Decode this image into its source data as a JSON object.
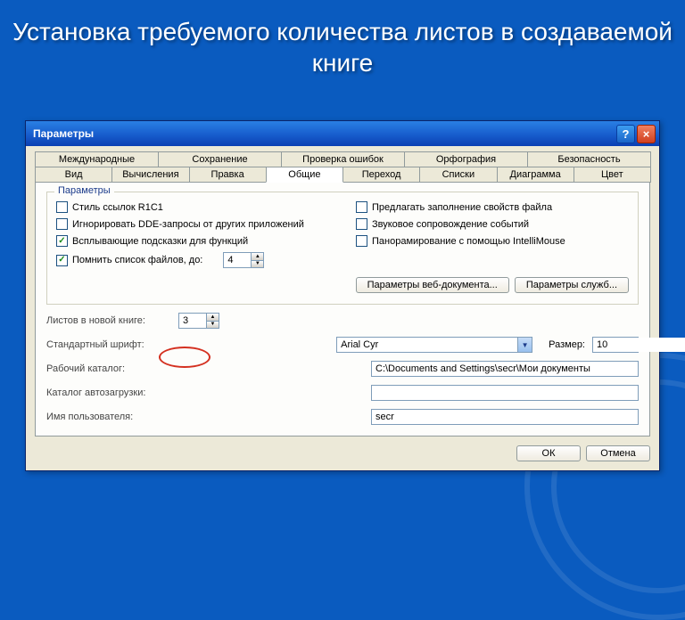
{
  "slide_title": "Установка требуемого количества листов в создаваемой книге",
  "dialog": {
    "title": "Параметры"
  },
  "tabs_row1": [
    "Международные",
    "Сохранение",
    "Проверка ошибок",
    "Орфография",
    "Безопасность"
  ],
  "tabs_row2": [
    "Вид",
    "Вычисления",
    "Правка",
    "Общие",
    "Переход",
    "Списки",
    "Диаграмма",
    "Цвет"
  ],
  "section_legend": "Параметры",
  "checks_left": [
    {
      "label": "Стиль ссылок R1C1",
      "checked": false
    },
    {
      "label": "Игнорировать DDE-запросы от других приложений",
      "checked": false
    },
    {
      "label": "Всплывающие подсказки для функций",
      "checked": true
    },
    {
      "label": "Помнить список файлов, до:",
      "checked": true
    }
  ],
  "checks_right": [
    {
      "label": "Предлагать заполнение свойств файла",
      "checked": false
    },
    {
      "label": "Звуковое сопровождение событий",
      "checked": false
    },
    {
      "label": "Панорамирование с помощью IntelliMouse",
      "checked": false
    }
  ],
  "recent_files_value": "4",
  "btn_webopts": "Параметры веб-документа...",
  "btn_svcopts": "Параметры служб...",
  "form": {
    "sheets_label": "Листов в новой книге:",
    "sheets_value": "3",
    "font_label": "Стандартный шрифт:",
    "font_value": "Arial Cyr",
    "size_label": "Размер:",
    "size_value": "10",
    "workdir_label": "Рабочий каталог:",
    "workdir_value": "C:\\Documents and Settings\\secr\\Мои документы",
    "autoload_label": "Каталог автозагрузки:",
    "autoload_value": "",
    "username_label": "Имя пользователя:",
    "username_value": "secr"
  },
  "ok_label": "ОК",
  "cancel_label": "Отмена"
}
